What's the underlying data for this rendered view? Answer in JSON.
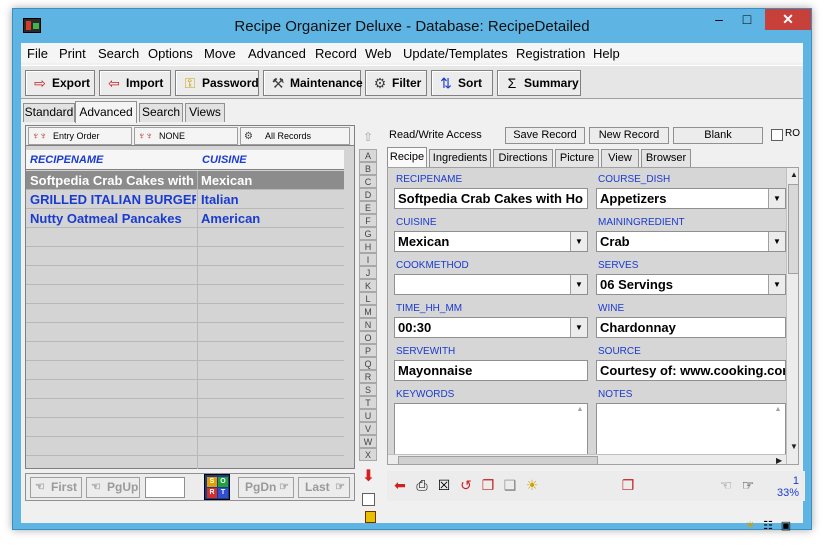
{
  "window": {
    "title": "Recipe Organizer Deluxe - Database: RecipeDetailed",
    "min": "–",
    "max": "□",
    "close": "✕"
  },
  "menu": [
    "File",
    "Print",
    "Search",
    "Options",
    "Move",
    "Advanced",
    "Record",
    "Web",
    "Update/Templates",
    "Registration",
    "Help"
  ],
  "toolbar": [
    {
      "label": "Export",
      "icon": "export-icon"
    },
    {
      "label": "Import",
      "icon": "import-icon"
    },
    {
      "label": "Password",
      "icon": "key-icon"
    },
    {
      "label": "Maintenance",
      "icon": "maintenance-icon"
    },
    {
      "label": "Filter",
      "icon": "filter-icon"
    },
    {
      "label": "Sort",
      "icon": "sort-icon"
    },
    {
      "label": "Summary",
      "icon": "sigma-icon"
    }
  ],
  "view_tabs": [
    "Standard",
    "Advanced",
    "Search",
    "Views"
  ],
  "active_view_tab": "Advanced",
  "sort_buttons": [
    "Entry Order",
    "NONE",
    "All Records"
  ],
  "grid": {
    "columns": [
      "RECIPENAME",
      "CUISINE"
    ],
    "rows": [
      {
        "name": "Softpedia Crab Cakes with",
        "cuisine": "Mexican",
        "selected": true
      },
      {
        "name": "GRILLED ITALIAN BURGER",
        "cuisine": "Italian",
        "selected": false
      },
      {
        "name": "Nutty Oatmeal Pancakes",
        "cuisine": "American",
        "selected": false
      }
    ]
  },
  "nav": {
    "first": "First",
    "pgup": "PgUp",
    "pgdn": "PgDn",
    "last": "Last",
    "center_letters": [
      "S",
      "O",
      "R",
      "T"
    ]
  },
  "alphabet": [
    "A",
    "B",
    "C",
    "D",
    "E",
    "F",
    "G",
    "H",
    "I",
    "J",
    "K",
    "L",
    "M",
    "N",
    "O",
    "P",
    "Q",
    "R",
    "S",
    "T",
    "U",
    "V",
    "W",
    "X"
  ],
  "record": {
    "read_write": "Read/Write Access",
    "save": "Save Record",
    "new": "New Record",
    "blank": "Blank",
    "ro": "RO"
  },
  "detail_tabs": [
    "Recipe",
    "Ingredients",
    "Directions",
    "Picture",
    "View",
    "Browser"
  ],
  "active_detail_tab": "Recipe",
  "fields": {
    "recipename": {
      "label": "RECIPENAME",
      "value": "Softpedia Crab Cakes with Ho"
    },
    "course_dish": {
      "label": "COURSE_DISH",
      "value": "Appetizers"
    },
    "cuisine": {
      "label": "CUISINE",
      "value": "Mexican"
    },
    "mainingredient": {
      "label": "MAININGREDIENT",
      "value": "Crab"
    },
    "cookmethod": {
      "label": "COOKMETHOD",
      "value": ""
    },
    "serves": {
      "label": "SERVES",
      "value": "06 Servings"
    },
    "time": {
      "label": "TIME_HH_MM",
      "value": "00:30"
    },
    "wine": {
      "label": "WINE",
      "value": "Chardonnay"
    },
    "servewith": {
      "label": "SERVEWITH",
      "value": "Mayonnaise"
    },
    "source": {
      "label": "SOURCE",
      "value": "Courtesy of: www.cooking.com"
    },
    "keywords": {
      "label": "KEYWORDS",
      "value": ""
    },
    "notes": {
      "label": "NOTES",
      "value": ""
    }
  },
  "record_count": {
    "current": "1",
    "percent": "33%"
  },
  "colors": {
    "accent": "#1a3bd0",
    "selected_row": "#8c8c8c",
    "frame": "#5eb5e3"
  }
}
